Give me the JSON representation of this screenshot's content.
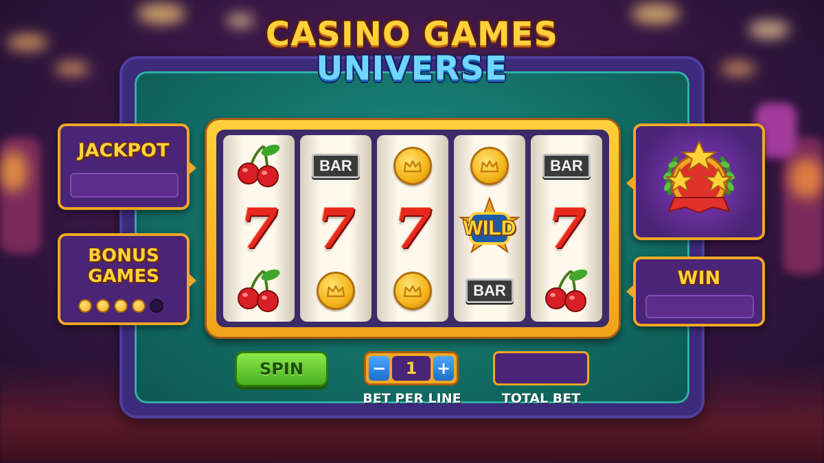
{
  "title": {
    "line1": "CASINO GAMES",
    "line2": "UNIVERSE"
  },
  "left_panels": {
    "jackpot": {
      "label": "JACKPOT",
      "value": ""
    },
    "bonus": {
      "label_line1": "BONUS",
      "label_line2": "GAMES",
      "dots_filled": 4,
      "dots_total": 5
    }
  },
  "right_panels": {
    "achievement": {
      "icon": "stars-trophy-icon"
    },
    "win": {
      "label": "WIN",
      "value": ""
    }
  },
  "reels": [
    [
      "cherry",
      "seven",
      "cherry"
    ],
    [
      "bar",
      "seven",
      "coin"
    ],
    [
      "coin",
      "seven",
      "coin"
    ],
    [
      "coin",
      "wild",
      "bar"
    ],
    [
      "bar",
      "seven",
      "cherry"
    ]
  ],
  "symbols": {
    "seven": "7",
    "bar": "BAR",
    "wild": "WILD"
  },
  "controls": {
    "spin_label": "SPIN",
    "bet_minus": "−",
    "bet_plus": "+",
    "bet_per_line_value": "1",
    "bet_per_line_label": "BET PER LINE",
    "total_bet_value": "",
    "total_bet_label": "TOTAL BET"
  },
  "colors": {
    "gold": "#ffd23a",
    "panel_purple": "#4a2476",
    "teal": "#137066",
    "spin_green": "#46b21f"
  }
}
